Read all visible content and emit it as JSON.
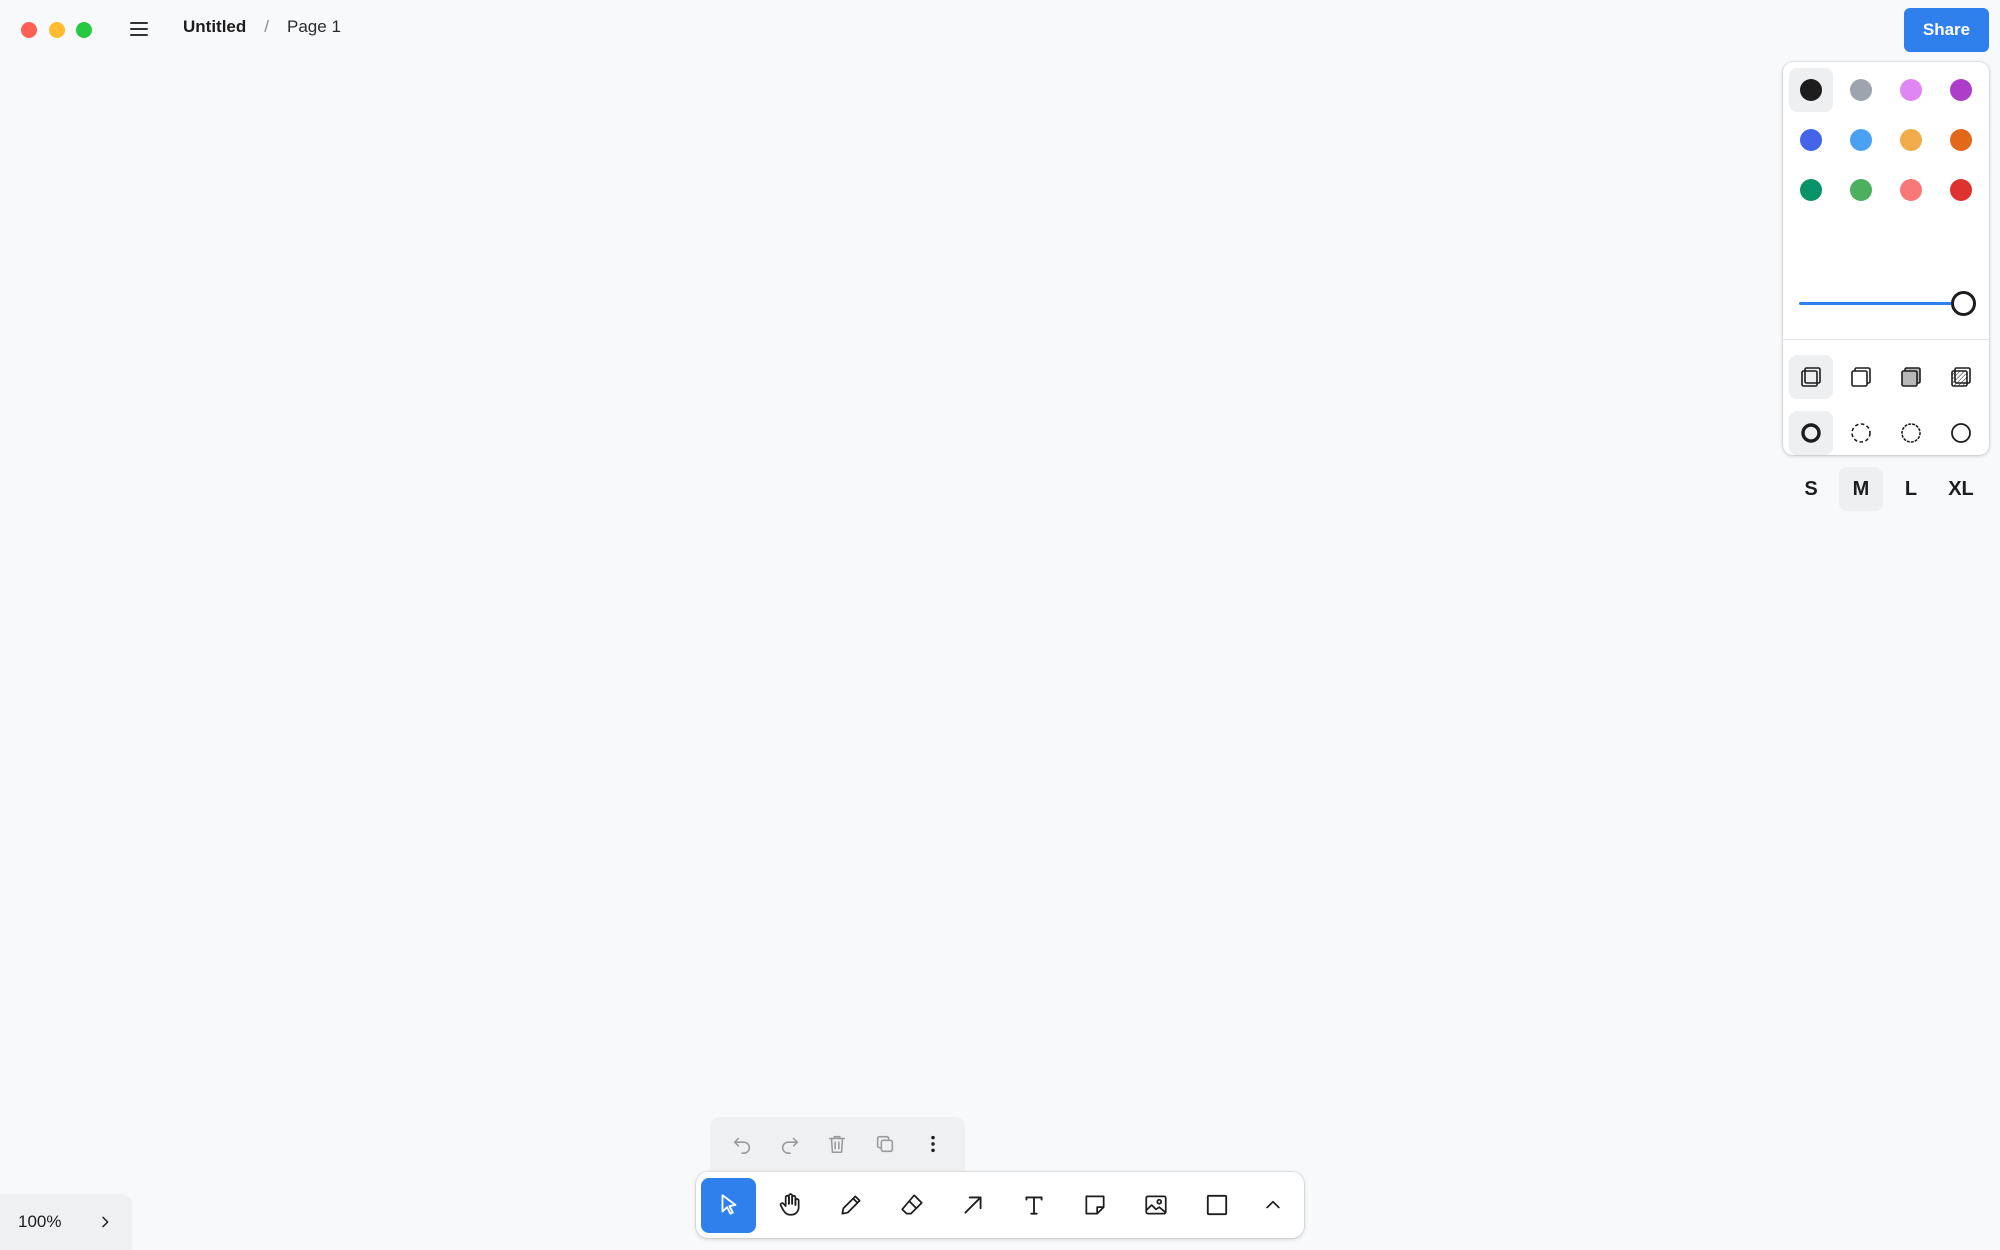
{
  "header": {
    "document_title": "Untitled",
    "separator": "/",
    "page_name": "Page 1",
    "share_label": "Share"
  },
  "style_panel": {
    "colors": [
      {
        "name": "black",
        "hex": "#1d1d1d",
        "selected": true
      },
      {
        "name": "grey",
        "hex": "#9ea4ad",
        "selected": false
      },
      {
        "name": "light-violet",
        "hex": "#e085f4",
        "selected": false
      },
      {
        "name": "violet",
        "hex": "#ae3ec9",
        "selected": false
      },
      {
        "name": "blue",
        "hex": "#4465e9",
        "selected": false
      },
      {
        "name": "light-blue",
        "hex": "#4ba1f1",
        "selected": false
      },
      {
        "name": "yellow",
        "hex": "#f1ac4b",
        "selected": false
      },
      {
        "name": "orange",
        "hex": "#e16919",
        "selected": false
      },
      {
        "name": "green",
        "hex": "#099268",
        "selected": false
      },
      {
        "name": "light-green",
        "hex": "#4cb05e",
        "selected": false
      },
      {
        "name": "light-red",
        "hex": "#f87777",
        "selected": false
      },
      {
        "name": "red",
        "hex": "#e03131",
        "selected": false
      }
    ],
    "opacity": 1.0,
    "accent_color": "#2f80ed",
    "fill_options": [
      {
        "name": "fill-none-icon",
        "selected": true
      },
      {
        "name": "fill-semi-icon",
        "selected": false
      },
      {
        "name": "fill-solid-icon",
        "selected": false
      },
      {
        "name": "fill-pattern-icon",
        "selected": false
      }
    ],
    "dash_options": [
      {
        "name": "dash-draw-icon",
        "selected": true
      },
      {
        "name": "dash-dashed-icon",
        "selected": false
      },
      {
        "name": "dash-dotted-icon",
        "selected": false
      },
      {
        "name": "dash-solid-icon",
        "selected": false
      }
    ],
    "sizes": [
      {
        "label": "S",
        "selected": false
      },
      {
        "label": "M",
        "selected": true
      },
      {
        "label": "L",
        "selected": false
      },
      {
        "label": "XL",
        "selected": false
      }
    ]
  },
  "quick_actions": [
    "undo-icon",
    "redo-icon",
    "trash-icon",
    "duplicate-icon",
    "more-vertical-icon"
  ],
  "toolbar": {
    "tools": [
      "select-icon",
      "hand-icon",
      "pencil-icon",
      "eraser-icon",
      "arrow-icon",
      "text-icon",
      "note-icon",
      "image-icon",
      "rectangle-icon"
    ],
    "active_tool": "select-icon",
    "more_icon": "chevron-up-icon"
  },
  "zoom": {
    "level": "100%",
    "toggle_icon": "chevron-right-icon"
  }
}
